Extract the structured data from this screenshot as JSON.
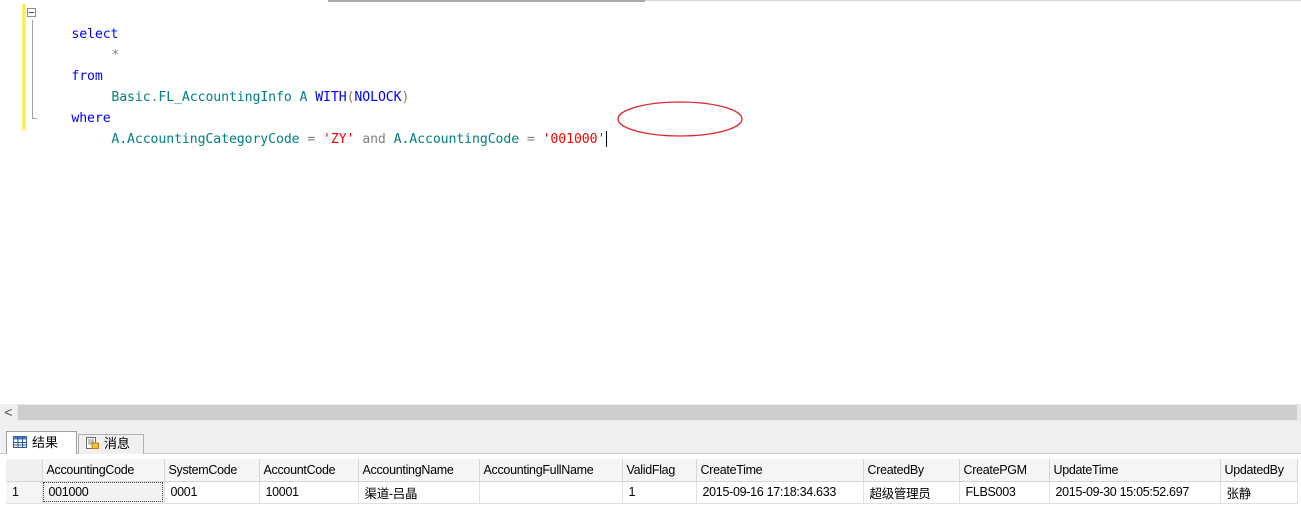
{
  "query": {
    "select_kw": "select",
    "star": "*",
    "from_kw": "from",
    "table_schema": "Basic",
    "table_dot": ".",
    "table_name": "FL_AccountingInfo",
    "alias": "A",
    "with_kw": "WITH",
    "paren_open": "(",
    "nolock_kw": "NOLOCK",
    "paren_close": ")",
    "where_kw": "where",
    "cond1_col": "A.AccountingCategoryCode",
    "eq": "=",
    "cond1_val": "'ZY'",
    "and_kw": "and",
    "cond2_col": "A.AccountingCode",
    "cond2_val": "'001000'"
  },
  "results_pane": {
    "tabs": [
      {
        "label": "结果",
        "icon": "grid-table-icon"
      },
      {
        "label": "消息",
        "icon": "messages-icon"
      }
    ]
  },
  "grid": {
    "columns": [
      "AccountingCode",
      "SystemCode",
      "AccountCode",
      "AccountingName",
      "AccountingFullName",
      "ValidFlag",
      "CreateTime",
      "CreatedBy",
      "CreatePGM",
      "UpdateTime",
      "UpdatedBy"
    ],
    "rows": [
      {
        "rownum": "1",
        "cells": [
          "001000",
          "0001",
          "10001",
          "渠道-吕晶",
          "",
          "1",
          "2015-09-16 17:18:34.633",
          "超级管理员",
          "FLBS003",
          "2015-09-30 15:05:52.697",
          "张静"
        ]
      }
    ]
  },
  "colors": {
    "keyword": "#0000ff",
    "object": "#008080",
    "operator": "#808080",
    "string": "#ff0000",
    "annotation_circle": "#e0262a",
    "change_marker": "#ffee62"
  },
  "scrollbar": {
    "left_arrow": "<"
  }
}
